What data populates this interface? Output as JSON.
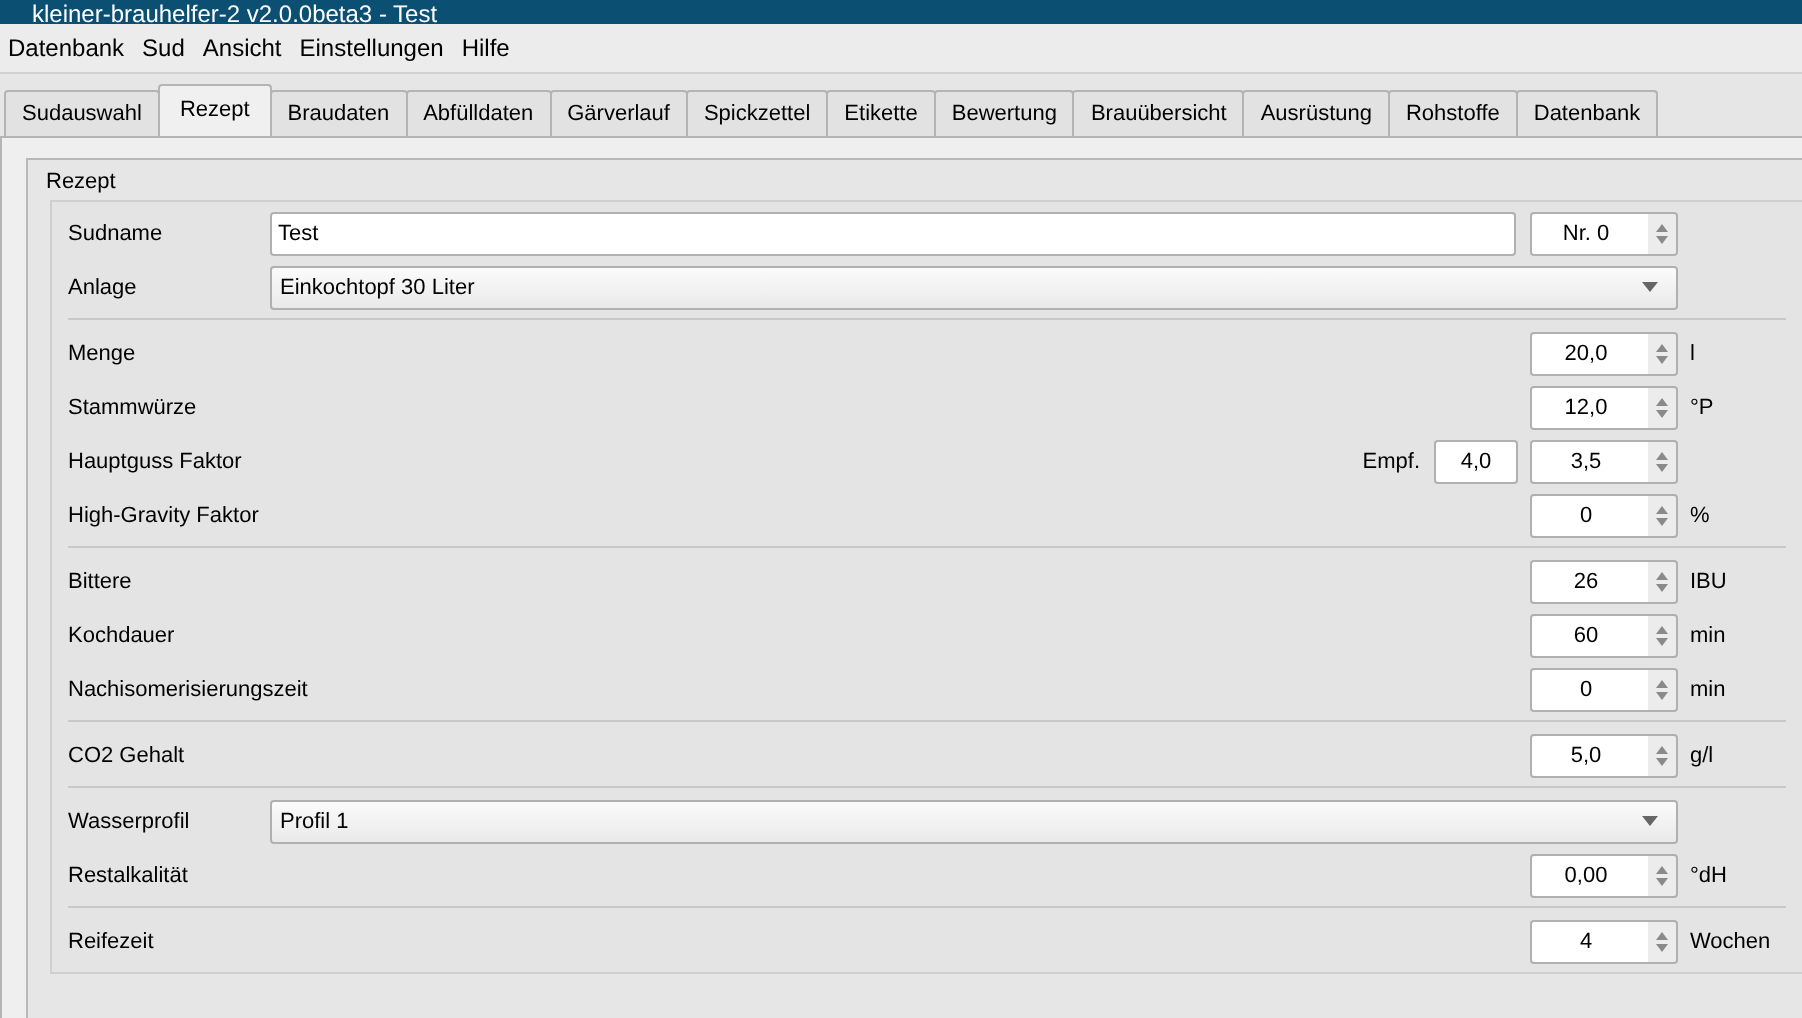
{
  "window": {
    "title": "kleiner-brauhelfer-2 v2.0.0beta3 -  Test"
  },
  "menu": [
    "Datenbank",
    "Sud",
    "Ansicht",
    "Einstellungen",
    "Hilfe"
  ],
  "tabs": [
    {
      "label": "Sudauswahl",
      "selected": false
    },
    {
      "label": "Rezept",
      "selected": true
    },
    {
      "label": "Braudaten",
      "selected": false
    },
    {
      "label": "Abfülldaten",
      "selected": false
    },
    {
      "label": "Gärverlauf",
      "selected": false
    },
    {
      "label": "Spickzettel",
      "selected": false
    },
    {
      "label": "Etikette",
      "selected": false
    },
    {
      "label": "Bewertung",
      "selected": false
    },
    {
      "label": "Brauübersicht",
      "selected": false
    },
    {
      "label": "Ausrüstung",
      "selected": false
    },
    {
      "label": "Rohstoffe",
      "selected": false
    },
    {
      "label": "Datenbank",
      "selected": false
    }
  ],
  "group": {
    "title": "Rezept",
    "sections": [
      {
        "rows": [
          {
            "label": "Sudname",
            "kind": "text",
            "value": "Test",
            "number": "Nr. 0"
          },
          {
            "label": "Anlage",
            "kind": "combo",
            "value": "Einkochtopf 30 Liter"
          }
        ]
      },
      {
        "rows": [
          {
            "label": "Menge",
            "kind": "spin",
            "value": "20,0",
            "unit": "l"
          },
          {
            "label": "Stammwürze",
            "kind": "spin",
            "value": "12,0",
            "unit": "°P"
          },
          {
            "label": "Hauptguss Faktor",
            "kind": "spin",
            "value": "3,5",
            "recommended_label": "Empf.",
            "recommended": "4,0"
          },
          {
            "label": "High-Gravity Faktor",
            "kind": "spin",
            "value": "0",
            "unit": "%"
          }
        ]
      },
      {
        "rows": [
          {
            "label": "Bittere",
            "kind": "spin",
            "value": "26",
            "unit": "IBU"
          },
          {
            "label": "Kochdauer",
            "kind": "spin",
            "value": "60",
            "unit": "min"
          },
          {
            "label": "Nachisomerisierungszeit",
            "kind": "spin",
            "value": "0",
            "unit": "min"
          }
        ]
      },
      {
        "rows": [
          {
            "label": "CO2 Gehalt",
            "kind": "spin",
            "value": "5,0",
            "unit": "g/l"
          }
        ]
      },
      {
        "rows": [
          {
            "label": "Wasserprofil",
            "kind": "combo",
            "value": "Profil 1"
          },
          {
            "label": "Restalkalität",
            "kind": "spin",
            "value": "0,00",
            "unit": "°dH"
          }
        ]
      },
      {
        "rows": [
          {
            "label": "Reifezeit",
            "kind": "spin",
            "value": "4",
            "unit": "Wochen"
          }
        ]
      }
    ]
  }
}
